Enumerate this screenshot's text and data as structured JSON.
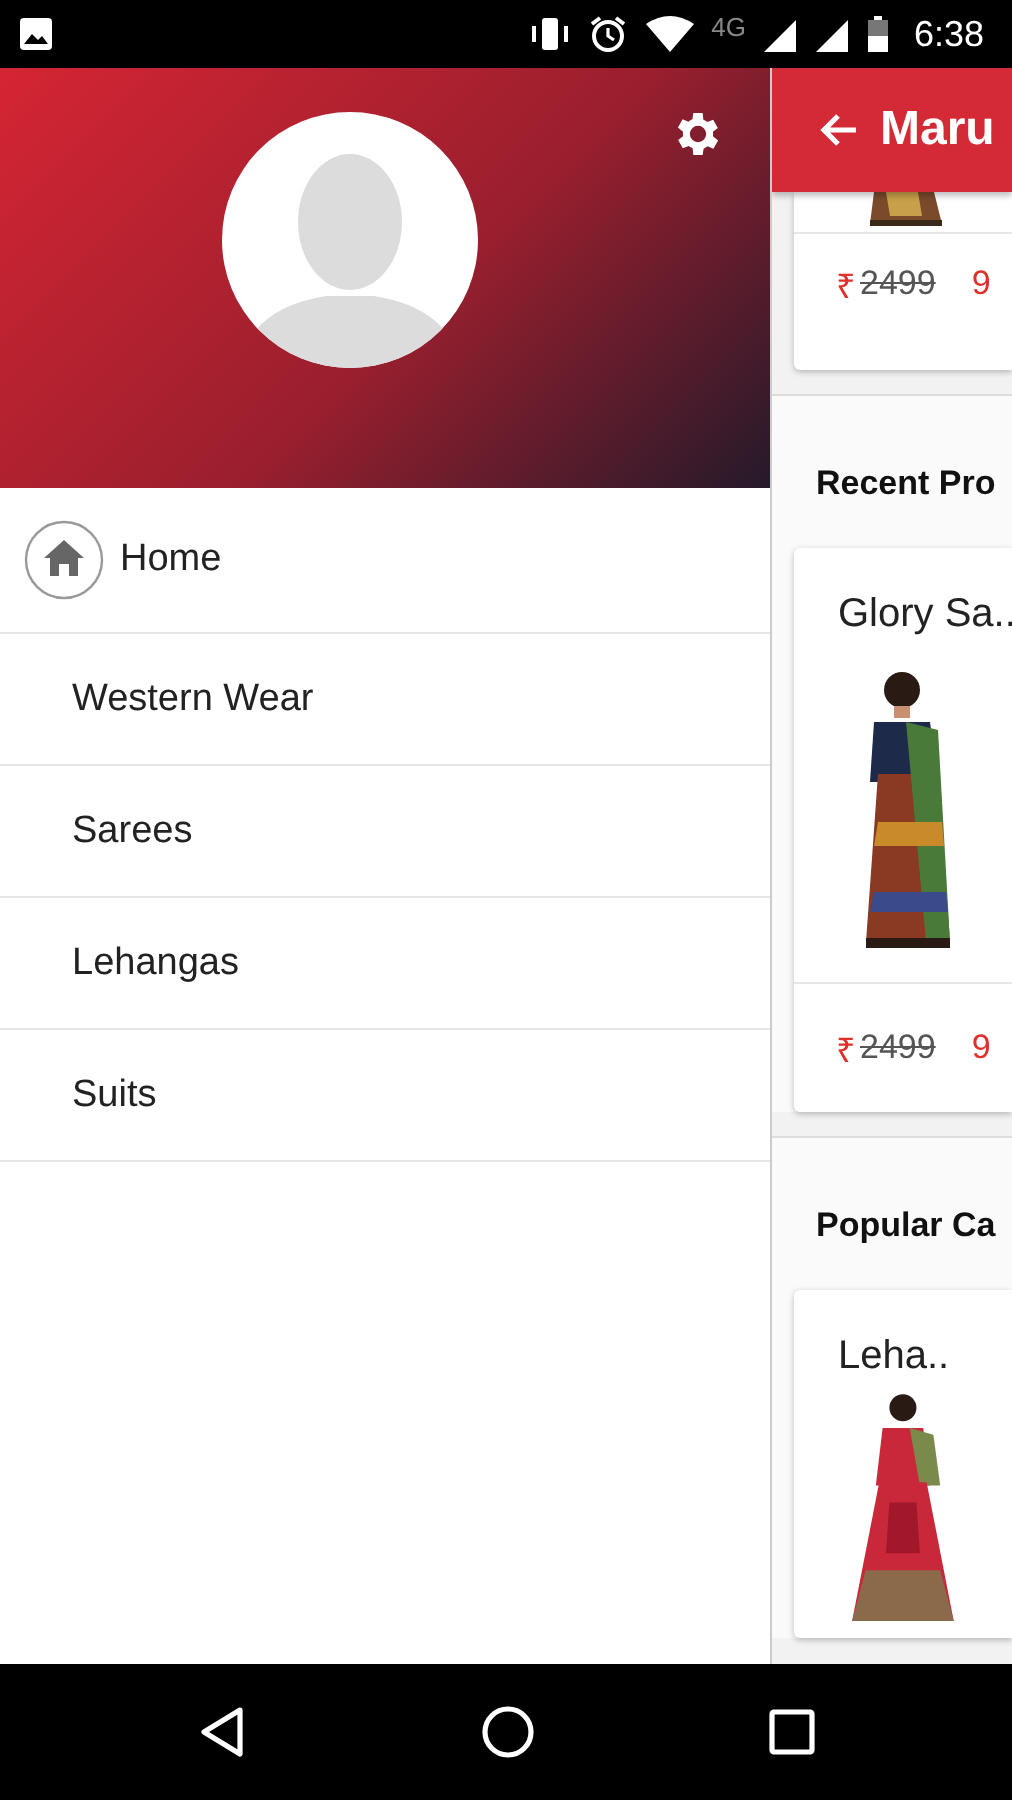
{
  "status_bar": {
    "network": "4G",
    "time": "6:38"
  },
  "drawer": {
    "menu": [
      {
        "kind": "icon",
        "label": "Home"
      },
      {
        "kind": "plain",
        "label": "Western Wear"
      },
      {
        "kind": "plain",
        "label": "Sarees"
      },
      {
        "kind": "plain",
        "label": "Lehangas"
      },
      {
        "kind": "plain",
        "label": "Suits"
      }
    ]
  },
  "content": {
    "app_bar": {
      "title": "Maru"
    },
    "top_card": {
      "currency": "₹",
      "price_old": "2499",
      "price_new": "9"
    },
    "sections": [
      {
        "heading": "Recent Pro",
        "card": {
          "title": "Glory Sa..",
          "kind": "saree",
          "currency": "₹",
          "price_old": "2499",
          "price_new": "9"
        }
      },
      {
        "heading": "Popular Ca",
        "card": {
          "title": "Leha..",
          "kind": "lehanga"
        }
      }
    ]
  }
}
